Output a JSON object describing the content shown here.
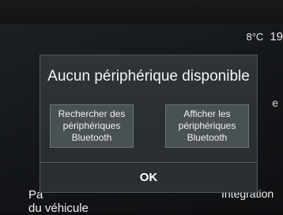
{
  "status": {
    "temperature": "8°C",
    "time_partial": "19"
  },
  "background": {
    "right_partial": "e",
    "left_bottom": "Pa\ndu véhicule",
    "right_bottom": "Integration"
  },
  "dialog": {
    "title": "Aucun périphérique disponible",
    "search_button": "Rechercher des périphériques Bluetooth",
    "show_button": "Afficher les périphériques Bluetooth",
    "ok_button": "OK"
  }
}
